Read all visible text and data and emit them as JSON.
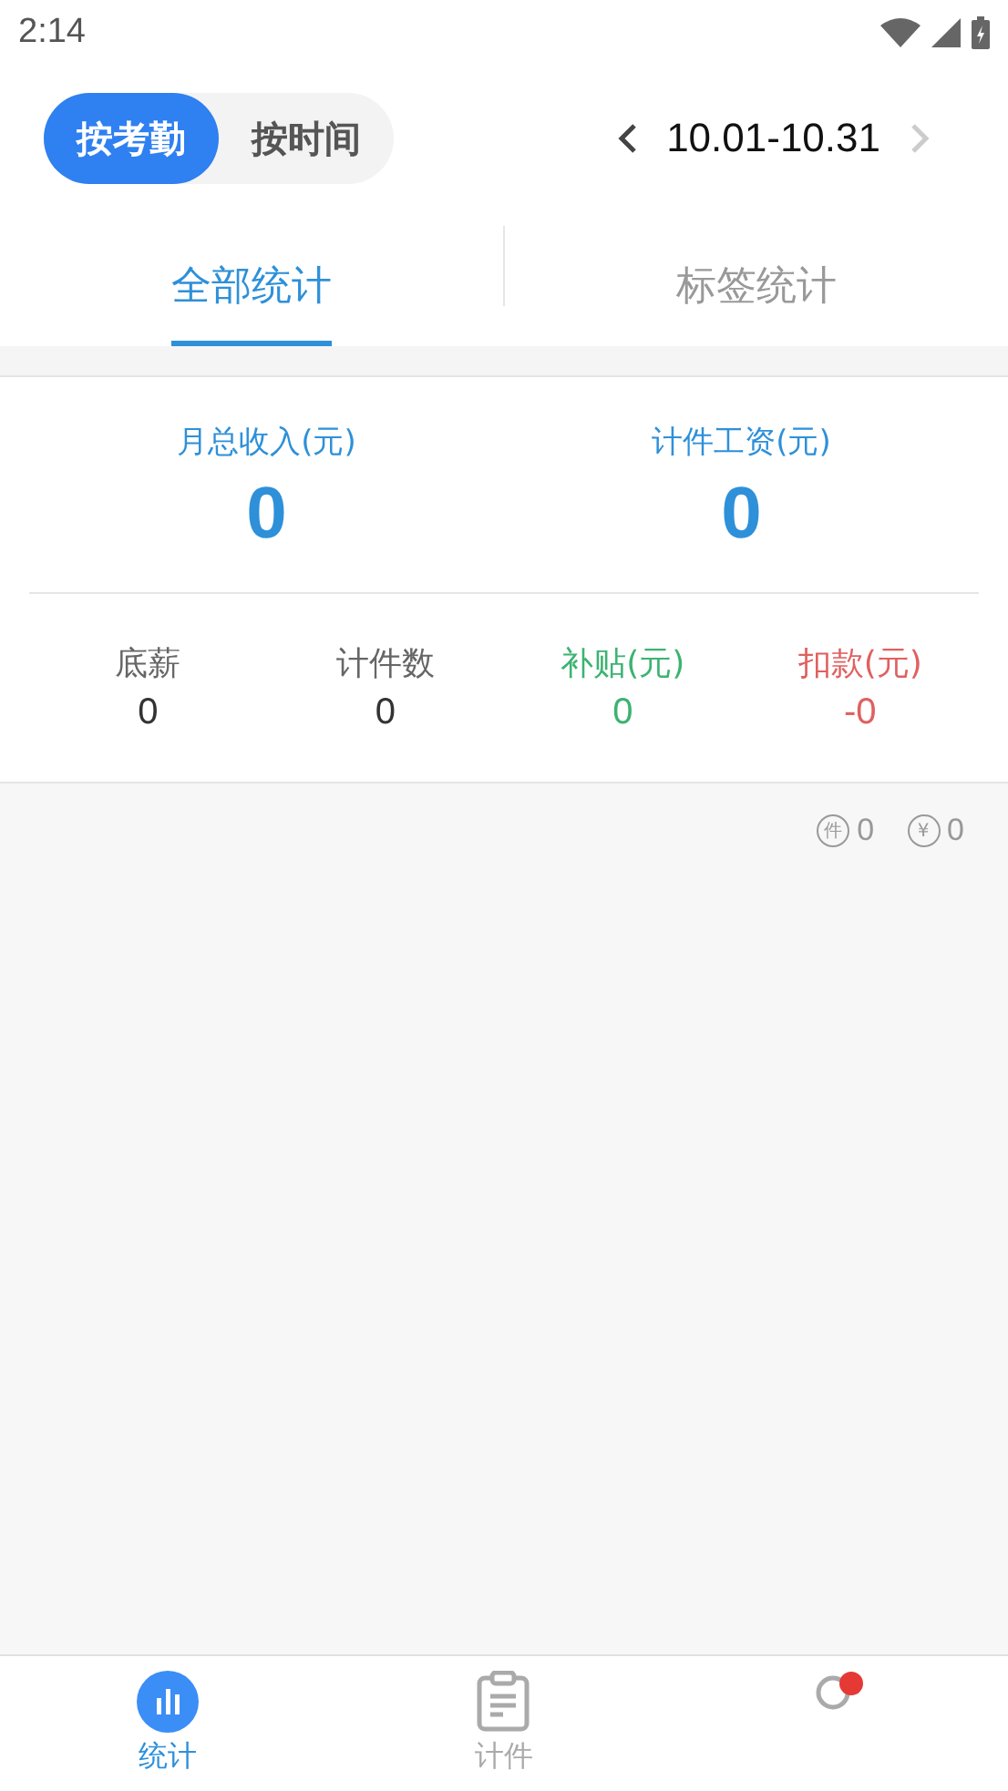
{
  "status_bar": {
    "time": "2:14"
  },
  "mode_toggle": [
    {
      "label": "按考勤",
      "selected": true
    },
    {
      "label": "按时间",
      "selected": false
    }
  ],
  "date_range": {
    "text": "10.01-10.31",
    "prev_disabled": false,
    "next_disabled": true
  },
  "tabs": [
    {
      "label": "全部统计",
      "selected": true
    },
    {
      "label": "标签统计",
      "selected": false
    }
  ],
  "summary": [
    {
      "label": "月总收入(元)",
      "value": "0"
    },
    {
      "label": "计件工资(元)",
      "value": "0"
    }
  ],
  "details": [
    {
      "label": "底薪",
      "value": "0",
      "color": "#666666"
    },
    {
      "label": "计件数",
      "value": "0",
      "color": "#666666"
    },
    {
      "label": "补贴(元)",
      "value": "0",
      "color": "#3cb371"
    },
    {
      "label": "扣款(元)",
      "value": "-0",
      "color": "#e06060"
    }
  ],
  "counters": [
    {
      "badge": "件",
      "value": "0"
    },
    {
      "badge": "¥",
      "value": "0"
    }
  ],
  "bottom_nav": [
    {
      "kind": "stats",
      "label": "统计",
      "selected": true
    },
    {
      "kind": "pieces",
      "label": "计件",
      "selected": false
    },
    {
      "kind": "profile",
      "selected": false,
      "dot": true
    }
  ]
}
